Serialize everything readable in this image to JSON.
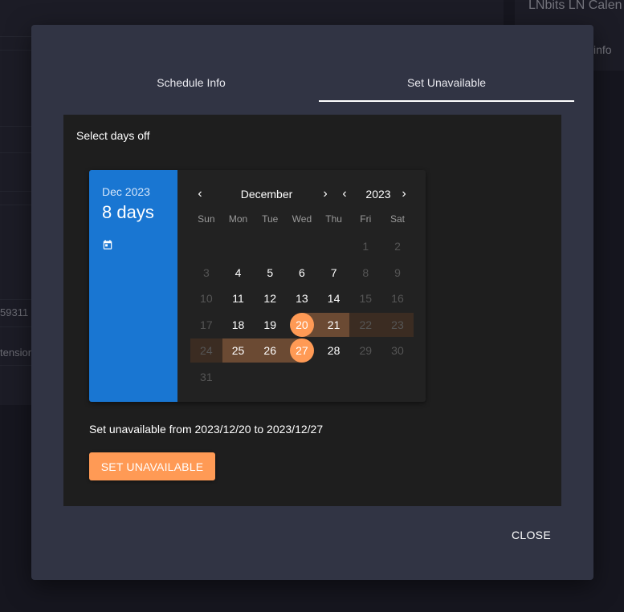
{
  "background": {
    "title": "LNbits LN Calen",
    "info_label": "info",
    "frag_number": "59311",
    "frag_text": "tension"
  },
  "dialog": {
    "tabs": [
      {
        "label": "Schedule Info",
        "active": false
      },
      {
        "label": "Set Unavailable",
        "active": true
      }
    ],
    "panel_label": "Select days off",
    "date_picker": {
      "header_subtitle": "Dec 2023",
      "header_title": "8 days",
      "edit_icon": "calendar-icon",
      "month": "December",
      "year": "2023",
      "prev_month": "‹",
      "next_month": "›",
      "prev_year": "‹",
      "next_year": "›",
      "weekdays": [
        "Sun",
        "Mon",
        "Tue",
        "Wed",
        "Thu",
        "Fri",
        "Sat"
      ],
      "days": [
        {
          "d": "",
          "c": "empty"
        },
        {
          "d": "",
          "c": "empty"
        },
        {
          "d": "",
          "c": "empty"
        },
        {
          "d": "",
          "c": "empty"
        },
        {
          "d": "",
          "c": "empty"
        },
        {
          "d": "1",
          "c": "disabled"
        },
        {
          "d": "2",
          "c": "disabled"
        },
        {
          "d": "3",
          "c": "disabled"
        },
        {
          "d": "4",
          "c": "normal"
        },
        {
          "d": "5",
          "c": "normal"
        },
        {
          "d": "6",
          "c": "normal"
        },
        {
          "d": "7",
          "c": "normal"
        },
        {
          "d": "8",
          "c": "disabled"
        },
        {
          "d": "9",
          "c": "disabled"
        },
        {
          "d": "10",
          "c": "disabled"
        },
        {
          "d": "11",
          "c": "normal"
        },
        {
          "d": "12",
          "c": "normal"
        },
        {
          "d": "13",
          "c": "normal"
        },
        {
          "d": "14",
          "c": "normal"
        },
        {
          "d": "15",
          "c": "disabled"
        },
        {
          "d": "16",
          "c": "disabled"
        },
        {
          "d": "17",
          "c": "disabled"
        },
        {
          "d": "18",
          "c": "normal"
        },
        {
          "d": "19",
          "c": "normal"
        },
        {
          "d": "20",
          "c": "selected-start"
        },
        {
          "d": "21",
          "c": "in-range"
        },
        {
          "d": "22",
          "c": "in-range-disabled"
        },
        {
          "d": "23",
          "c": "in-range-disabled"
        },
        {
          "d": "24",
          "c": "in-range-disabled"
        },
        {
          "d": "25",
          "c": "in-range"
        },
        {
          "d": "26",
          "c": "in-range"
        },
        {
          "d": "27",
          "c": "selected-end"
        },
        {
          "d": "28",
          "c": "normal"
        },
        {
          "d": "29",
          "c": "disabled"
        },
        {
          "d": "30",
          "c": "disabled"
        },
        {
          "d": "31",
          "c": "disabled"
        }
      ]
    },
    "range_text": "Set unavailable from 2023/12/20 to 2023/12/27",
    "set_button": "SET UNAVAILABLE",
    "close_button": "CLOSE"
  },
  "colors": {
    "accent": "#ff9a55",
    "header_blue": "#1976d2",
    "range_fill": "#6b4a33"
  }
}
